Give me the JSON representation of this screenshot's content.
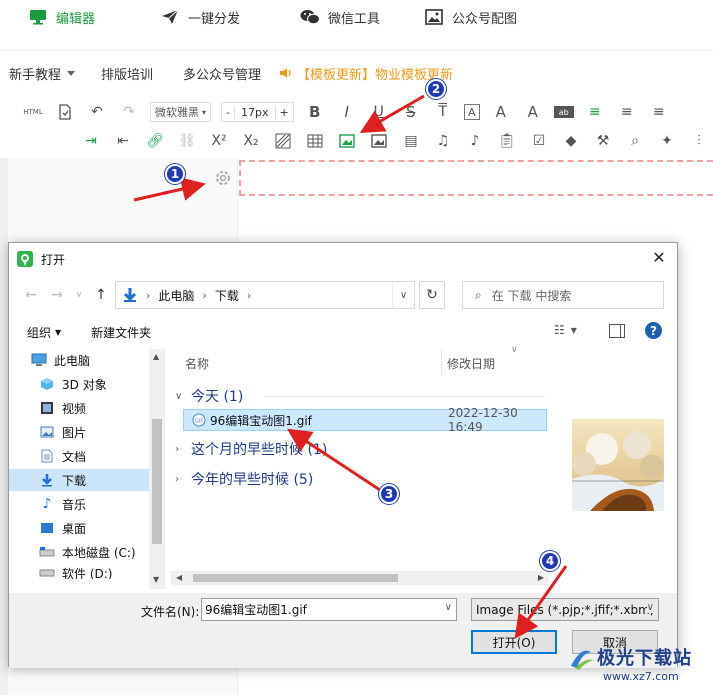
{
  "topnav": {
    "items": [
      {
        "label": "编辑器",
        "icon": "monitor-icon"
      },
      {
        "label": "一键分发",
        "icon": "send-icon"
      },
      {
        "label": "微信工具",
        "icon": "wechat-icon"
      },
      {
        "label": "公众号配图",
        "icon": "image-icon"
      }
    ],
    "active_color": "#1a9b3c"
  },
  "subnav": {
    "tutorial": "新手教程",
    "training": "排版培训",
    "multi": "多公众号管理",
    "notice": "【模板更新】物业模板更新",
    "notice_color": "#f29a1a"
  },
  "toolbar": {
    "font": "微软雅黑",
    "size_minus": "-",
    "size": "17px",
    "size_plus": "+"
  },
  "dialog": {
    "title": "打开",
    "path": [
      "此电脑",
      "下载"
    ],
    "search_placeholder": "在 下载 中搜索",
    "organize": "组织",
    "new_folder": "新建文件夹",
    "tree": [
      {
        "label": "此电脑",
        "icon": "computer-icon"
      },
      {
        "label": "3D 对象",
        "icon": "cube-icon"
      },
      {
        "label": "视频",
        "icon": "video-icon"
      },
      {
        "label": "图片",
        "icon": "picture-icon"
      },
      {
        "label": "文档",
        "icon": "document-icon"
      },
      {
        "label": "下载",
        "icon": "download-icon",
        "selected": true
      },
      {
        "label": "音乐",
        "icon": "music-icon"
      },
      {
        "label": "桌面",
        "icon": "desktop-icon"
      },
      {
        "label": "本地磁盘 (C:)",
        "icon": "disk-icon"
      },
      {
        "label": "软件 (D:)",
        "icon": "disk-icon"
      }
    ],
    "columns": {
      "name": "名称",
      "date": "修改日期"
    },
    "groups": [
      {
        "label": "今天 (1)"
      },
      {
        "label": "这个月的早些时候 (1)"
      },
      {
        "label": "今年的早些时候 (5)"
      }
    ],
    "file": {
      "name": "96编辑宝动图1.gif",
      "date": "2022-12-30 16:49"
    },
    "filename_label": "文件名(N):",
    "filename_value": "96编辑宝动图1.gif",
    "file_type": "Image Files (*.pjp;*.jfif;*.xbm;",
    "open_label": "打开(O)",
    "cancel_label": "取消"
  },
  "annotations": {
    "badges": [
      "1",
      "2",
      "3",
      "4"
    ],
    "arrow_color": "#e02020",
    "badge_color": "#1d3bb6"
  },
  "watermark": {
    "text": "极光下载站",
    "url": "www.xz7.com"
  }
}
